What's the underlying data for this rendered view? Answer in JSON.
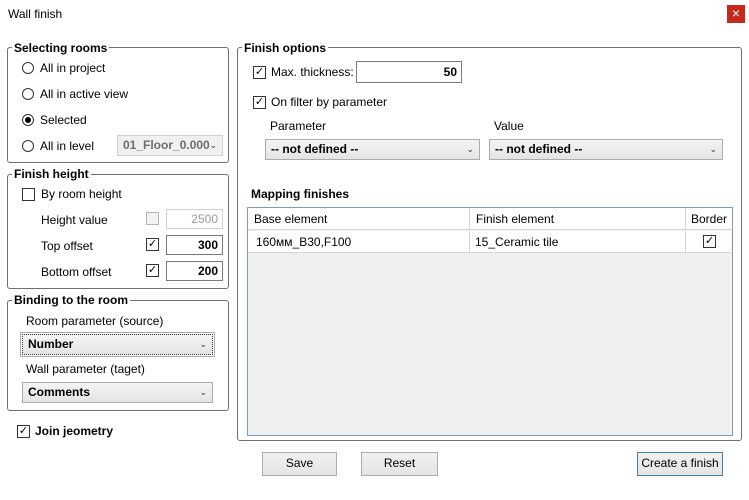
{
  "window": {
    "title": "Wall finish",
    "close_glyph": "×"
  },
  "selecting_rooms": {
    "title": "Selecting rooms",
    "options": [
      {
        "label": "All in project",
        "selected": false
      },
      {
        "label": "All in active view",
        "selected": false
      },
      {
        "label": "Selected",
        "selected": true
      },
      {
        "label": "All in level",
        "selected": false
      }
    ],
    "level_value": "01_Floor_0.000"
  },
  "finish_height": {
    "title": "Finish height",
    "by_room_height": {
      "label": "By room height",
      "checked": false
    },
    "height_value": {
      "label": "Height value",
      "checked": false,
      "value": "2500",
      "enabled": false
    },
    "top_offset": {
      "label": "Top offset",
      "checked": true,
      "value": "300"
    },
    "bottom_offset": {
      "label": "Bottom offset",
      "checked": true,
      "value": "200"
    }
  },
  "binding": {
    "title": "Binding to the room",
    "room_param_label": "Room parameter (source)",
    "room_param_value": "Number",
    "wall_param_label": "Wall parameter (taget)",
    "wall_param_value": "Comments"
  },
  "join_geometry": {
    "label": "Join jeometry",
    "checked": true
  },
  "finish_options": {
    "title": "Finish options",
    "max_thickness": {
      "label": "Max. thickness:",
      "checked": true,
      "value": "50"
    },
    "on_filter": {
      "label": "On filter by parameter",
      "checked": true
    },
    "parameter_label": "Parameter",
    "parameter_value": "-- not defined --",
    "value_label": "Value",
    "value_value": "-- not defined --"
  },
  "mapping": {
    "title": "Mapping finishes",
    "columns": [
      "Base element",
      "Finish element",
      "Border"
    ],
    "rows": [
      {
        "base": "160мм_B30,F100",
        "finish": "15_Ceramic tile",
        "border": true
      }
    ]
  },
  "buttons": {
    "save": "Save",
    "reset": "Reset",
    "create": "Create a finish"
  },
  "glyphs": {
    "check": "✓",
    "dropdown": "⌄"
  }
}
